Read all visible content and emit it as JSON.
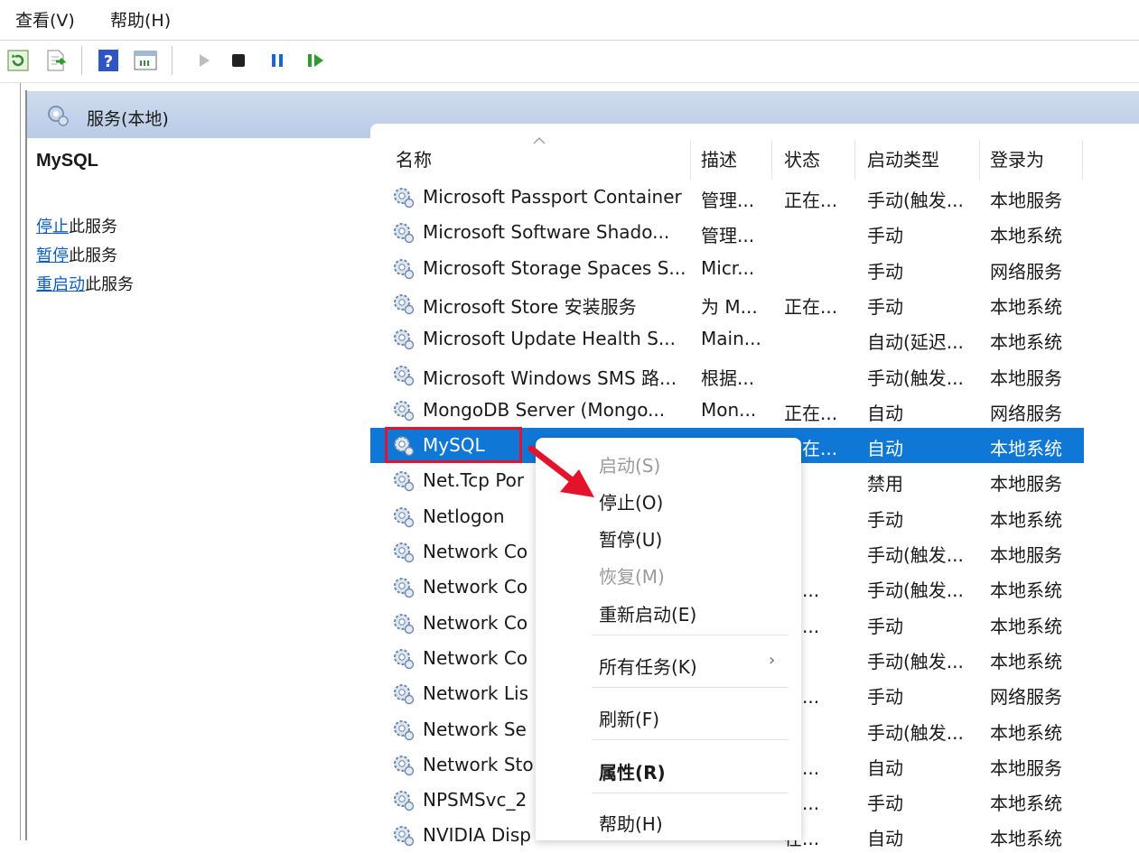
{
  "menubar": {
    "view": "查看(V)",
    "help": "帮助(H)"
  },
  "toolbar": {
    "buttons": [
      "refresh-icon",
      "export-icon",
      "help-icon",
      "console-icon",
      "start-icon",
      "stop-icon",
      "pause-icon",
      "resume-icon"
    ]
  },
  "header": {
    "title": "服务(本地)"
  },
  "left_pane": {
    "service_name": "MySQL",
    "actions": [
      {
        "link": "停止",
        "suffix": "此服务"
      },
      {
        "link": "暂停",
        "suffix": "此服务"
      },
      {
        "link": "重启动",
        "suffix": "此服务"
      }
    ]
  },
  "columns": {
    "name": "名称",
    "desc": "描述",
    "status": "状态",
    "startup": "启动类型",
    "logon": "登录为"
  },
  "rows": [
    {
      "name": "Microsoft Passport Container",
      "desc": "管理...",
      "status": "正在...",
      "startup": "手动(触发...",
      "logon": "本地服务"
    },
    {
      "name": "Microsoft Software Shado...",
      "desc": "管理...",
      "status": "",
      "startup": "手动",
      "logon": "本地系统"
    },
    {
      "name": "Microsoft Storage Spaces S...",
      "desc": "Micr...",
      "status": "",
      "startup": "手动",
      "logon": "网络服务"
    },
    {
      "name": "Microsoft Store 安装服务",
      "desc": "为 M...",
      "status": "正在...",
      "startup": "手动",
      "logon": "本地系统"
    },
    {
      "name": "Microsoft Update Health S...",
      "desc": "Main...",
      "status": "",
      "startup": "自动(延迟...",
      "logon": "本地系统"
    },
    {
      "name": "Microsoft Windows SMS 路...",
      "desc": "根据...",
      "status": "",
      "startup": "手动(触发...",
      "logon": "本地服务"
    },
    {
      "name": "MongoDB Server (Mongo...",
      "desc": "Mon...",
      "status": "正在...",
      "startup": "自动",
      "logon": "网络服务"
    },
    {
      "name": "MySQL",
      "desc": "",
      "status": "正在...",
      "startup": "自动",
      "logon": "本地系统"
    },
    {
      "name": "Net.Tcp Por",
      "desc": "",
      "status": "",
      "startup": "禁用",
      "logon": "本地服务"
    },
    {
      "name": "Netlogon",
      "desc": "",
      "status": "",
      "startup": "手动",
      "logon": "本地系统"
    },
    {
      "name": "Network Co",
      "desc": "",
      "status": "",
      "startup": "手动(触发...",
      "logon": "本地服务"
    },
    {
      "name": "Network Co",
      "desc": "",
      "status": "在...",
      "startup": "手动(触发...",
      "logon": "本地系统"
    },
    {
      "name": "Network Co",
      "desc": "",
      "status": "在...",
      "startup": "手动",
      "logon": "本地系统"
    },
    {
      "name": "Network Co",
      "desc": "",
      "status": "",
      "startup": "手动(触发...",
      "logon": "本地系统"
    },
    {
      "name": "Network Lis",
      "desc": "",
      "status": "在...",
      "startup": "手动",
      "logon": "网络服务"
    },
    {
      "name": "Network Se",
      "desc": "",
      "status": "",
      "startup": "手动(触发...",
      "logon": "本地系统"
    },
    {
      "name": "Network Sto",
      "desc": "",
      "status": "在...",
      "startup": "自动",
      "logon": "本地服务"
    },
    {
      "name": "NPSMSvc_2",
      "desc": "",
      "status": "在...",
      "startup": "手动",
      "logon": "本地系统"
    },
    {
      "name": "NVIDIA Disp",
      "desc": "",
      "status": "在...",
      "startup": "自动",
      "logon": "本地系统"
    }
  ],
  "context_menu": {
    "items": [
      {
        "label": "启动(S)",
        "state": "disabled"
      },
      {
        "label": "停止(O)",
        "state": "enabled"
      },
      {
        "label": "暂停(U)",
        "state": "enabled"
      },
      {
        "label": "恢复(M)",
        "state": "disabled"
      },
      {
        "label": "重新启动(E)",
        "state": "enabled"
      },
      {
        "label": "所有任务(K)",
        "state": "enabled",
        "submenu": "›"
      },
      {
        "label": "刷新(F)",
        "state": "enabled"
      },
      {
        "label": "属性(R)",
        "state": "default"
      },
      {
        "label": "帮助(H)",
        "state": "enabled"
      }
    ]
  },
  "colors": {
    "selection": "#0f78d7",
    "highlight_box": "#e4122a",
    "link": "#0b5cc7",
    "header_band": "#c4d4ec"
  }
}
